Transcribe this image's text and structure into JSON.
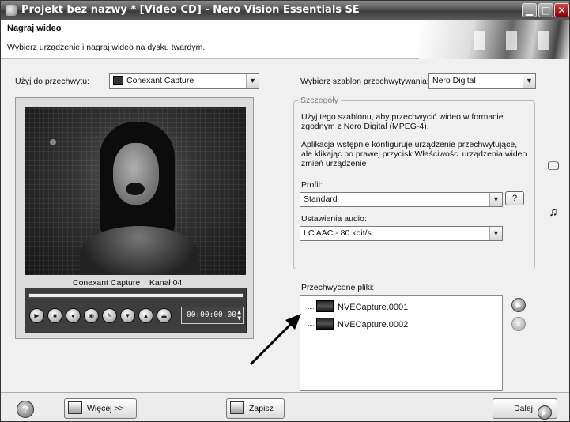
{
  "window": {
    "title": "Projekt bez nazwy * [Video CD] - Nero Vision Essentials SE",
    "controls": {
      "minimize": "▁",
      "maximize": "□",
      "close": "✕"
    }
  },
  "header": {
    "title": "Nagraj wideo",
    "subtitle": "Wybierz urządzenie i nagraj wideo na dysku twardym."
  },
  "capture_device": {
    "label": "Użyj do przechwytu:",
    "value": "Conexant Capture"
  },
  "template": {
    "label": "Wybierz szablon przechwytywania:",
    "value": "Nero Digital"
  },
  "preview": {
    "caption": "Conexant Capture    Kanał 04",
    "time": "00:00:00.00",
    "transport_icons": [
      "play-icon",
      "stop-icon",
      "record-icon",
      "snapshot-icon",
      "settings-icon",
      "down-icon",
      "up-icon",
      "eject-icon"
    ]
  },
  "details": {
    "legend": "Szczegóły",
    "description1": "Użyj tego szablonu, aby przechwycić wideo w formacie zgodnym z Nero Digital (MPEG-4).",
    "description2": "Aplikacja wstępnie konfiguruje urządzenie przechwytujące, ale klikając po prawej przycisk Właściwości urządzenia wideo zmień urządzenie",
    "profile_label": "Profil:",
    "profile_value": "Standard",
    "help_button": "?",
    "audio_label": "Ustawienia audio:",
    "audio_value": "LC AAC  - 80 kbit/s"
  },
  "captured": {
    "label": "Przechwycone pliki:",
    "files": [
      "NVECapture.0001",
      "NVECapture.0002"
    ]
  },
  "footer": {
    "help": "?",
    "more_button": "Więcej >>",
    "save_button": "Zapisz",
    "next_button": "Dalej"
  }
}
